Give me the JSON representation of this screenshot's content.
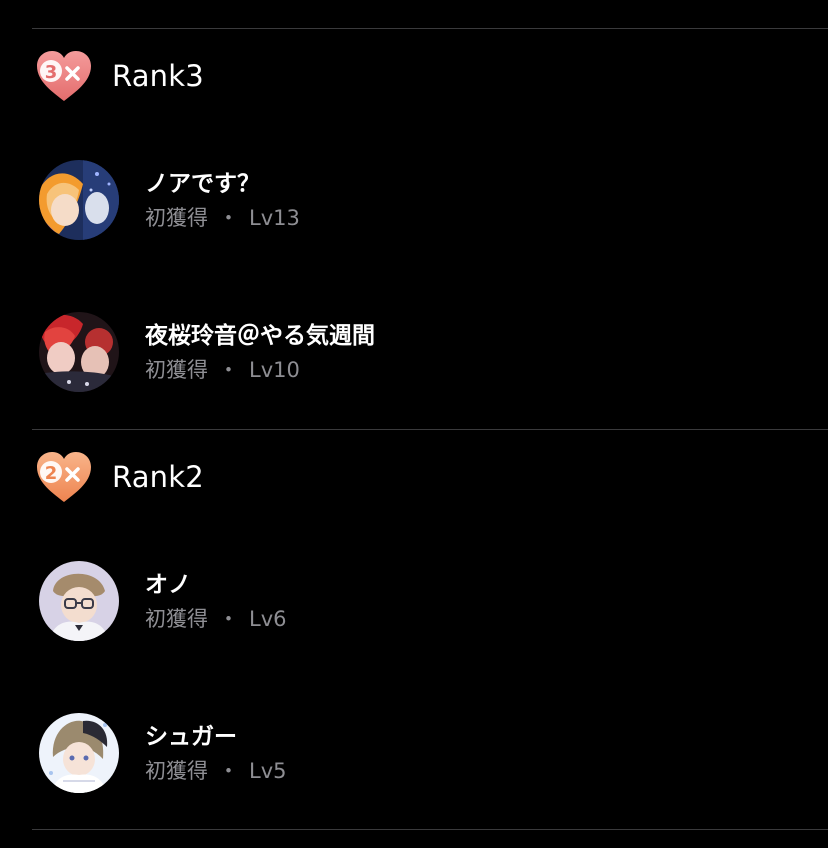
{
  "sections": [
    {
      "rank_number": "3",
      "title": "Rank3",
      "badge_color": "#ee8080",
      "users": [
        {
          "name": "ノアです？",
          "status": "初獲得",
          "level": "Lv13"
        },
        {
          "name": "夜桜玲音＠やる気週間",
          "status": "初獲得",
          "level": "Lv10"
        }
      ]
    },
    {
      "rank_number": "2",
      "title": "Rank2",
      "badge_color": "#f39a6b",
      "users": [
        {
          "name": "オノ",
          "status": "初獲得",
          "level": "Lv6"
        },
        {
          "name": "シュガー",
          "status": "初獲得",
          "level": "Lv5"
        }
      ]
    }
  ],
  "meta_separator": "・",
  "colors": {
    "background": "#000000",
    "text_primary": "#ffffff",
    "text_secondary": "#8e8e93",
    "divider": "#3a3a3c"
  }
}
